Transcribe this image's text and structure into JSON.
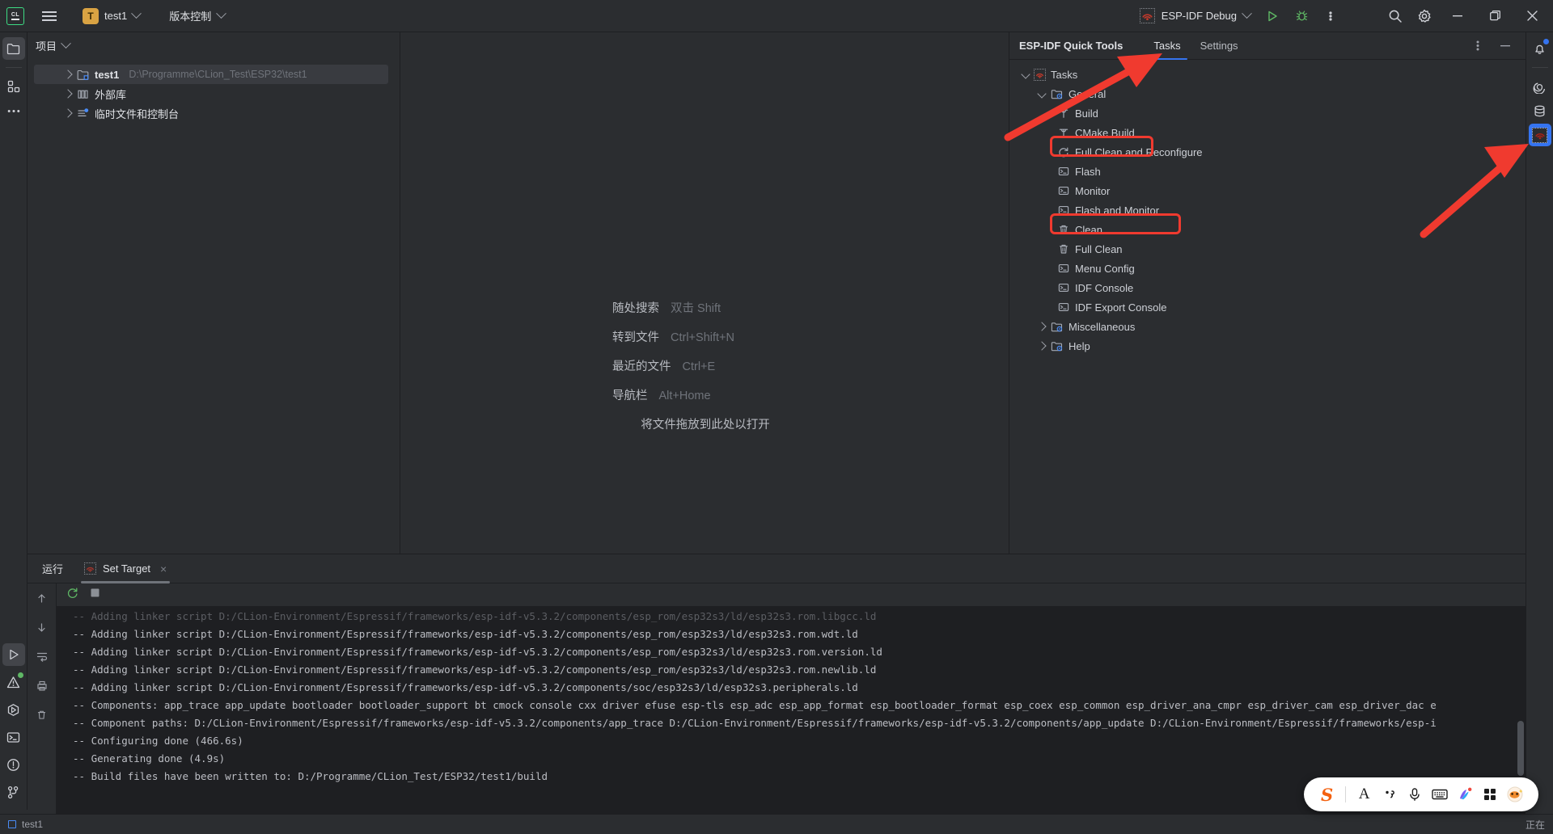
{
  "toolbar": {
    "logo": "clion-logo",
    "menu": "main-menu",
    "project_badge": "T",
    "project_name": "test1",
    "vcs_label": "版本控制",
    "run_config": "ESP-IDF Debug",
    "run_label": "run",
    "debug_label": "debug",
    "more_label": "more",
    "search_label": "search",
    "settings_label": "settings",
    "minimize_label": "minimize",
    "maximize_label": "maximize",
    "close_label": "close"
  },
  "project_panel": {
    "title": "项目",
    "nodes": [
      {
        "label": "test1",
        "path": "D:\\Programme\\CLion_Test\\ESP32\\test1",
        "icon": "module-folder-icon",
        "selected": true
      },
      {
        "label": "外部库",
        "path": "",
        "icon": "library-icon",
        "selected": false
      },
      {
        "label": "临时文件和控制台",
        "path": "",
        "icon": "scratches-icon",
        "selected": false
      }
    ]
  },
  "editor": {
    "hints": [
      {
        "name": "随处搜索",
        "key": "双击 Shift"
      },
      {
        "name": "转到文件",
        "key": "Ctrl+Shift+N"
      },
      {
        "name": "最近的文件",
        "key": "Ctrl+E"
      },
      {
        "name": "导航栏",
        "key": "Alt+Home"
      }
    ],
    "drop_hint": "将文件拖放到此处以打开"
  },
  "esp_panel": {
    "title": "ESP-IDF Quick Tools",
    "tabs": [
      {
        "label": "Tasks",
        "active": true
      },
      {
        "label": "Settings",
        "active": false
      }
    ],
    "options_label": "options",
    "hide_label": "hide",
    "tree": [
      {
        "label": "Tasks",
        "level": 0,
        "icon": "esp-logo-icon",
        "expander": "down",
        "highlight": false
      },
      {
        "label": "General",
        "level": 1,
        "icon": "folder-config-icon",
        "expander": "down",
        "highlight": false
      },
      {
        "label": "Build",
        "level": 2,
        "icon": "hammer-icon",
        "expander": "none",
        "highlight": false
      },
      {
        "label": "CMake Build",
        "level": 2,
        "icon": "hammer-icon",
        "expander": "none",
        "highlight": true
      },
      {
        "label": "Full Clean and Reconfigure",
        "level": 2,
        "icon": "refresh-icon",
        "expander": "none",
        "highlight": false
      },
      {
        "label": "Flash",
        "level": 2,
        "icon": "terminal-icon",
        "expander": "none",
        "highlight": false
      },
      {
        "label": "Monitor",
        "level": 2,
        "icon": "terminal-icon",
        "expander": "none",
        "highlight": false
      },
      {
        "label": "Flash and Monitor",
        "level": 2,
        "icon": "terminal-icon",
        "expander": "none",
        "highlight": true
      },
      {
        "label": "Clean",
        "level": 2,
        "icon": "trash-icon",
        "expander": "none",
        "highlight": false
      },
      {
        "label": "Full Clean",
        "level": 2,
        "icon": "trash-icon",
        "expander": "none",
        "highlight": false
      },
      {
        "label": "Menu Config",
        "level": 2,
        "icon": "terminal-icon",
        "expander": "none",
        "highlight": false
      },
      {
        "label": "IDF Console",
        "level": 2,
        "icon": "terminal-icon",
        "expander": "none",
        "highlight": false
      },
      {
        "label": "IDF Export Console",
        "level": 2,
        "icon": "terminal-icon",
        "expander": "none",
        "highlight": false
      },
      {
        "label": "Miscellaneous",
        "level": 1,
        "icon": "folder-config-icon",
        "expander": "right",
        "highlight": false
      },
      {
        "label": "Help",
        "level": 1,
        "icon": "folder-config-icon",
        "expander": "right",
        "highlight": false
      }
    ]
  },
  "run_window": {
    "title": "运行",
    "tab_label": "Set Target",
    "tab_close": "×",
    "rerun_label": "rerun",
    "stop_label": "stop",
    "console_lines": [
      "-- Adding linker script D:/CLion-Environment/Espressif/frameworks/esp-idf-v5.3.2/components/esp_rom/esp32s3/ld/esp32s3.rom.libgcc.ld",
      "-- Adding linker script D:/CLion-Environment/Espressif/frameworks/esp-idf-v5.3.2/components/esp_rom/esp32s3/ld/esp32s3.rom.wdt.ld",
      "-- Adding linker script D:/CLion-Environment/Espressif/frameworks/esp-idf-v5.3.2/components/esp_rom/esp32s3/ld/esp32s3.rom.version.ld",
      "-- Adding linker script D:/CLion-Environment/Espressif/frameworks/esp-idf-v5.3.2/components/esp_rom/esp32s3/ld/esp32s3.rom.newlib.ld",
      "-- Adding linker script D:/CLion-Environment/Espressif/frameworks/esp-idf-v5.3.2/components/soc/esp32s3/ld/esp32s3.peripherals.ld",
      "-- Components: app_trace app_update bootloader bootloader_support bt cmock console cxx driver efuse esp-tls esp_adc esp_app_format esp_bootloader_format esp_coex esp_common esp_driver_ana_cmpr esp_driver_cam esp_driver_dac e",
      "-- Component paths: D:/CLion-Environment/Espressif/frameworks/esp-idf-v5.3.2/components/app_trace D:/CLion-Environment/Espressif/frameworks/esp-idf-v5.3.2/components/app_update D:/CLion-Environment/Espressif/frameworks/esp-i",
      "-- Configuring done (466.6s)",
      "-- Generating done (4.9s)",
      "-- Build files have been written to: D:/Programme/CLion_Test/ESP32/test1/build"
    ]
  },
  "status_bar": {
    "project": "test1",
    "right_text": "正在"
  },
  "ime_toolbar": {
    "logo": "sogou-logo",
    "buttons": [
      "font-icon",
      "punctuation-icon",
      "microphone-icon",
      "keyboard-icon",
      "palette-icon",
      "apps-icon",
      "mascot-icon"
    ]
  },
  "left_rail": {
    "items": [
      {
        "icon": "project-folder-icon",
        "active": true
      },
      {
        "icon": "structure-icon",
        "active": false
      },
      {
        "icon": "more-tool-windows-icon",
        "active": false
      }
    ],
    "bottom_items": [
      {
        "icon": "run-icon",
        "active": true,
        "dot": false
      },
      {
        "icon": "problems-icon",
        "active": false,
        "dot": true
      },
      {
        "icon": "debug-icon",
        "active": false,
        "dot": false
      },
      {
        "icon": "terminal-icon",
        "active": false,
        "dot": false
      },
      {
        "icon": "notifications-problems-icon",
        "active": false,
        "dot": false
      },
      {
        "icon": "version-control-icon",
        "active": false,
        "dot": false
      }
    ]
  },
  "right_rail": {
    "items": [
      {
        "icon": "notifications-bell-icon",
        "dot": true,
        "selected": false
      },
      {
        "icon": "ai-assistant-icon",
        "dot": false,
        "selected": false
      },
      {
        "icon": "database-icon",
        "dot": false,
        "selected": false
      },
      {
        "icon": "esp-idf-icon",
        "dot": false,
        "selected": true
      }
    ]
  },
  "colors": {
    "accent": "#3574f0",
    "highlight_red": "#f03a2f",
    "background": "#2b2d30",
    "console_bg": "#1e1f22",
    "green": "#5fb865",
    "orange": "#d9a343"
  }
}
